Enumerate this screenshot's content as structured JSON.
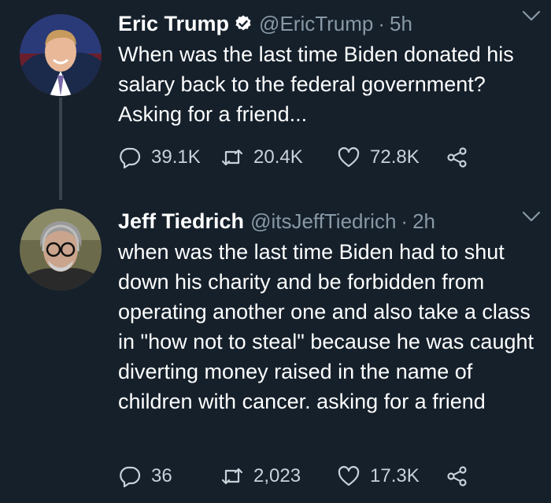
{
  "tweets": [
    {
      "name": "Eric Trump",
      "handle": "@EricTrump",
      "separator": "·",
      "time": "5h",
      "verified": true,
      "text": "When was the last time Biden donated his salary back to the federal government? Asking for a friend...",
      "replies": "39.1K",
      "retweets": "20.4K",
      "likes": "72.8K"
    },
    {
      "name": "Jeff Tiedrich",
      "handle": "@itsJeffTiedrich",
      "separator": "·",
      "time": "2h",
      "verified": false,
      "text": "when was the last time Biden had to shut down his charity and be forbidden from operating another one and also take a class in \"how not to steal\" because he was caught diverting money raised in the name of children with cancer. asking for a friend",
      "replies": "36",
      "retweets": "2,023",
      "likes": "17.3K"
    }
  ],
  "icons": {
    "verified": "verified-badge-icon",
    "caret": "chevron-down-icon",
    "reply": "reply-icon",
    "retweet": "retweet-icon",
    "like": "heart-icon",
    "share": "share-icon"
  },
  "colors": {
    "background": "#15202b",
    "secondary_text": "#8899a6",
    "thread_line": "#38444d"
  }
}
